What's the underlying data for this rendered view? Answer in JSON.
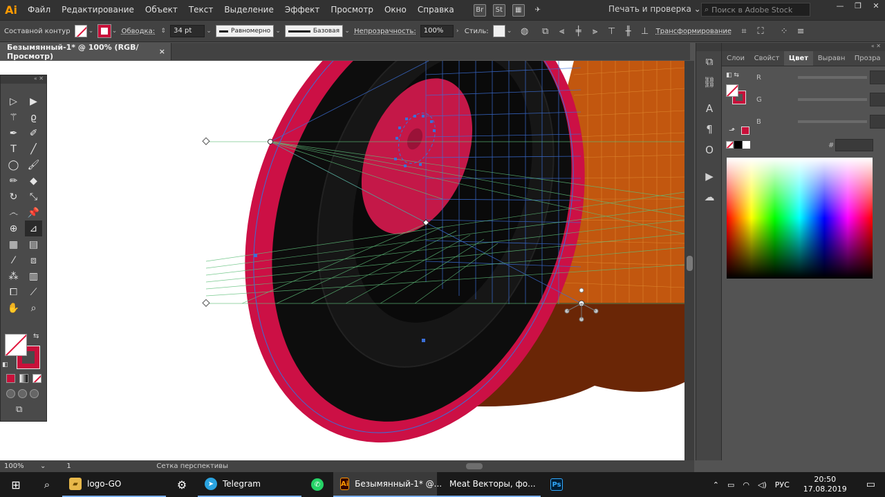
{
  "app": {
    "logo": "Ai",
    "menus": [
      "Файл",
      "Редактирование",
      "Объект",
      "Текст",
      "Выделение",
      "Эффект",
      "Просмотр",
      "Окно",
      "Справка"
    ],
    "bridge": "Br",
    "stock": "St",
    "workspace": "Печать и проверка",
    "search_placeholder": "Поиск в Adobe Stock"
  },
  "control": {
    "object_type": "Составной контур",
    "stroke_label": "Обводка:",
    "stroke_weight": "34 pt",
    "profile": "Равномерно",
    "brush": "Базовая",
    "opacity_label": "Непрозрачность:",
    "opacity": "100%",
    "style_label": "Стиль:",
    "transform": "Трансформирование"
  },
  "document": {
    "tab_title": "Безымянный-1* @ 100% (RGB/Просмотр)",
    "close": "×"
  },
  "status": {
    "zoom": "100%",
    "artboard": "1",
    "tool": "Сетка перспективы"
  },
  "color_panel": {
    "tabs": [
      "Слои",
      "Свойст",
      "Цвет",
      "Выравн",
      "Прозра"
    ],
    "active_tab": "Цвет",
    "r_label": "R",
    "g_label": "G",
    "b_label": "B",
    "hex_label": "#"
  },
  "taskbar": {
    "items": [
      "logo-GO",
      "Telegram",
      "Безымянный-1* @...",
      "Meat Векторы, фо..."
    ],
    "lang": "РУС",
    "time": "20:50",
    "date": "17.08.2019"
  },
  "colors": {
    "accent": "#c8103a",
    "canvas_orange": "#c2570f",
    "canvas_brown": "#6a2606",
    "guide_blue": "#3b6fd8",
    "guide_green": "#5fbf7a"
  }
}
